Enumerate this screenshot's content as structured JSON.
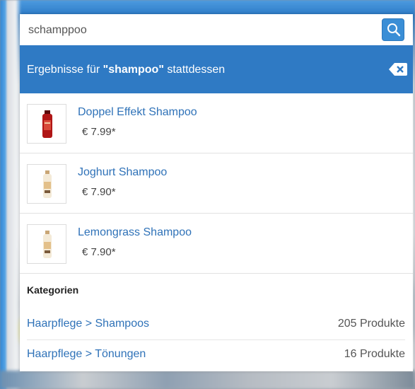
{
  "search": {
    "value": "schamppoo"
  },
  "banner": {
    "prefix": "Ergebnisse für ",
    "term": "\"shampoo\"",
    "suffix": " stattdessen"
  },
  "products": [
    {
      "name": "Doppel Effekt Shampoo",
      "price": "€ 7.99*",
      "icon": "red-bottle-icon"
    },
    {
      "name": "Joghurt Shampoo",
      "price": "€ 7.90*",
      "icon": "cream-bottle-icon"
    },
    {
      "name": "Lemongrass Shampoo",
      "price": "€ 7.90*",
      "icon": "cream-bottle-icon"
    }
  ],
  "categories": {
    "heading": "Kategorien",
    "items": [
      {
        "label": "Haarpflege > Shampoos",
        "count": "205 Produkte"
      },
      {
        "label": "Haarpflege > Tönungen",
        "count": "16 Produkte"
      }
    ]
  },
  "colors": {
    "accent": "#2f7ac4",
    "link": "#2f72b8",
    "button": "#3a8ed6"
  }
}
